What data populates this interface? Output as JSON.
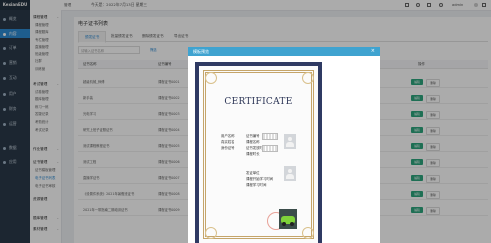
{
  "sidebar_main": {
    "logo": "KexianEDU",
    "items": [
      {
        "label": "概览",
        "icon": "home-icon"
      },
      {
        "label": "内容",
        "icon": "content-icon",
        "active": true
      },
      {
        "label": "订单",
        "icon": "order-icon"
      },
      {
        "label": "营销",
        "icon": "marketing-icon"
      },
      {
        "label": "互动",
        "icon": "interact-icon"
      },
      {
        "label": "用户",
        "icon": "user-icon"
      },
      {
        "label": "财务",
        "icon": "finance-icon"
      },
      {
        "label": "运营",
        "icon": "operate-icon"
      },
      {
        "label": "数据",
        "icon": "data-icon"
      },
      {
        "label": "应用",
        "icon": "app-icon"
      }
    ]
  },
  "sidebar_sub": {
    "groups": [
      {
        "title": "课程管理",
        "items": [
          "课程管理",
          "课程题库",
          "专栏管理",
          "直播管理",
          "班级管理",
          "社群",
          "训练营"
        ]
      },
      {
        "title": "考试管理",
        "items": [
          "试卷管理",
          "题库管理",
          "练习一练",
          "答疑记录",
          "考勤统计",
          "考试记录"
        ]
      },
      {
        "title": "作业管理",
        "items": []
      },
      {
        "title": "证书管理",
        "items": [
          "证书模板管理",
          "电子证书列表",
          "电子证书审核"
        ]
      },
      {
        "title": "资源管理",
        "items": []
      },
      {
        "title": "题库管理",
        "items": []
      },
      {
        "title": "素材管理",
        "items": []
      }
    ]
  },
  "topbar": {
    "breadcrumb": "管理",
    "date": "今天是：2022年7月13日 星期三",
    "user": "admin"
  },
  "content": {
    "title": "电子证书列表",
    "tabs": [
      "颁发证书",
      "批量颁发证书",
      "删除颁发证书",
      "导出证书"
    ],
    "filter_placeholder": "请输入证书名称",
    "filter_button": "筛选",
    "columns": [
      "证书名称",
      "证书编号",
      "颁发时间",
      "状态",
      "操作"
    ],
    "rows": [
      {
        "name": "超级机械_师傅",
        "no": "课程证书0001"
      },
      {
        "name": "新手装",
        "no": "课程证书0002"
      },
      {
        "name": "光电学习",
        "no": "课程证书0003"
      },
      {
        "name": "研究上班子证照证书",
        "no": "课程证书0004"
      },
      {
        "name": "测试课程教程证书",
        "no": "课程证书0005"
      },
      {
        "name": "测试工程",
        "no": "课程证书0006"
      },
      {
        "name": "直播学证书",
        "no": "课程证书0007"
      },
      {
        "name": "《设置件系统》2021年暑假班证书",
        "no": "课程证书0008"
      },
      {
        "name": "2021年一带指南二期培训证书",
        "no": "课程证书0009"
      }
    ],
    "action_primary": "编辑",
    "action_secondary": "删除"
  },
  "modal": {
    "title": "模板预览",
    "close": "×",
    "certificate": {
      "heading": "CERTIFICATE",
      "left_fields": [
        "用户名称",
        "真实姓名",
        "身份证号"
      ],
      "right_fields": [
        "证书编号",
        "课程名称",
        "证书发放时间",
        "课程时长"
      ],
      "mid_fields": [
        "发证单位",
        "课程开始学习时间",
        "课程学习时间"
      ]
    }
  }
}
